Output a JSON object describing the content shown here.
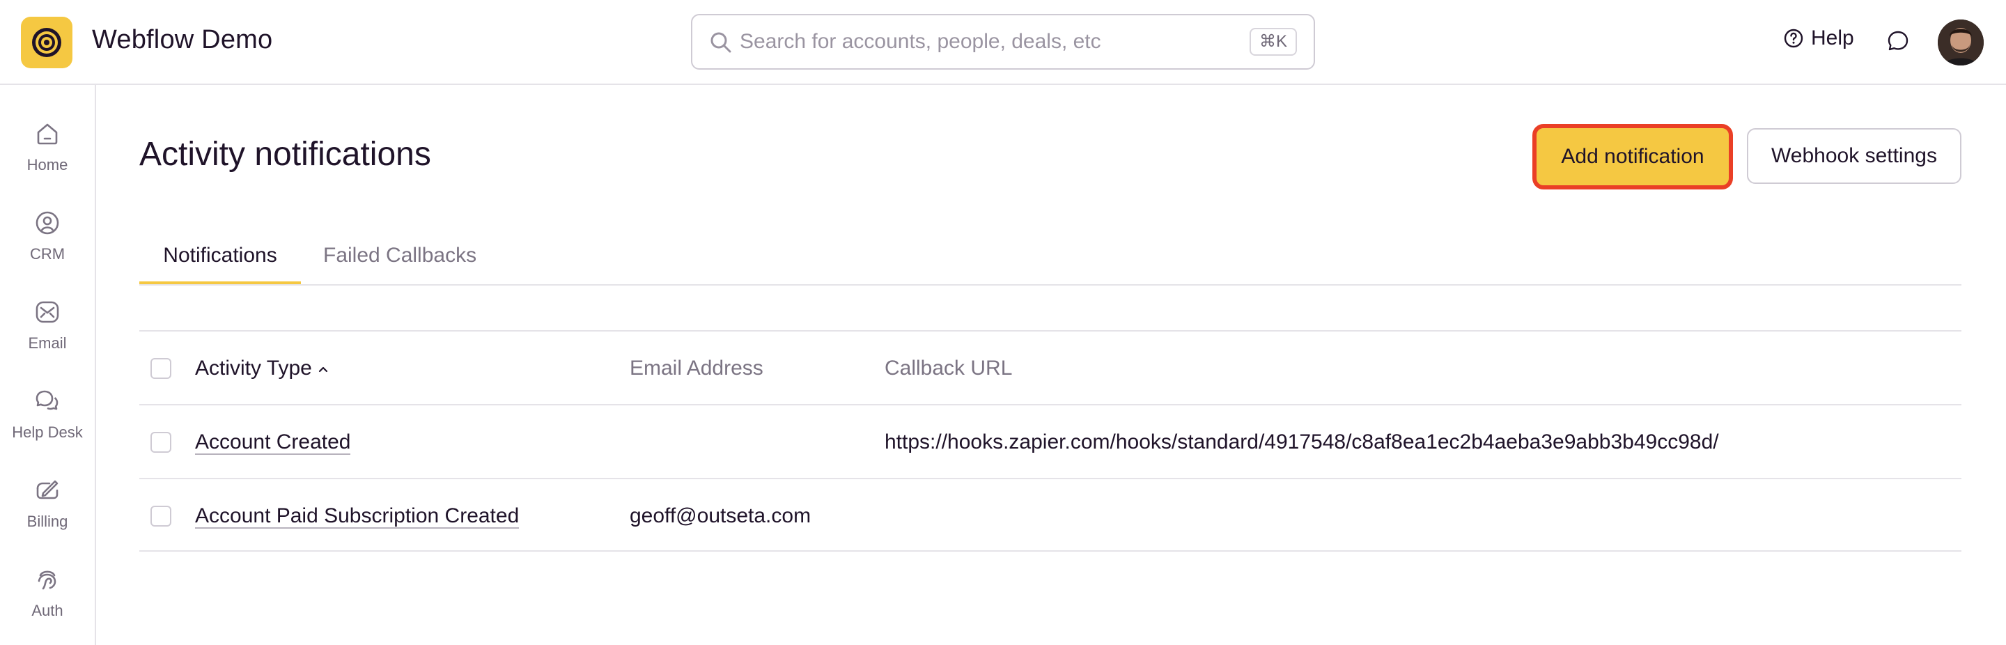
{
  "app": {
    "title": "Webflow Demo"
  },
  "search": {
    "placeholder": "Search for accounts, people, deals, etc",
    "shortcut": "⌘K",
    "value": ""
  },
  "header": {
    "help_label": "Help"
  },
  "sidebar": {
    "items": [
      {
        "label": "Home",
        "icon": "home-icon"
      },
      {
        "label": "CRM",
        "icon": "user-circle-icon"
      },
      {
        "label": "Email",
        "icon": "email-icon"
      },
      {
        "label": "Help Desk",
        "icon": "chat-bubbles-icon"
      },
      {
        "label": "Billing",
        "icon": "billing-icon"
      },
      {
        "label": "Auth",
        "icon": "fingerprint-icon"
      }
    ]
  },
  "page": {
    "title": "Activity notifications",
    "primary_button": "Add notification",
    "secondary_button": "Webhook settings"
  },
  "tabs": [
    {
      "label": "Notifications",
      "active": true
    },
    {
      "label": "Failed Callbacks",
      "active": false
    }
  ],
  "table": {
    "columns": [
      "Activity Type",
      "Email Address",
      "Callback URL"
    ],
    "sorted_column": "Activity Type",
    "sort_direction": "ascending",
    "rows": [
      {
        "activity_type": "Account Created",
        "email": "",
        "callback_url": "https://hooks.zapier.com/hooks/standard/4917548/c8af8ea1ec2b4aeba3e9abb3b49cc98d/"
      },
      {
        "activity_type": "Account Paid Subscription Created",
        "email": "geoff@outseta.com",
        "callback_url": ""
      }
    ]
  },
  "colors": {
    "accent": "#f5c842",
    "highlight_border": "#ea3f26",
    "text": "#1f1329",
    "muted_text": "#7b7483",
    "border": "#e5e3e8"
  }
}
